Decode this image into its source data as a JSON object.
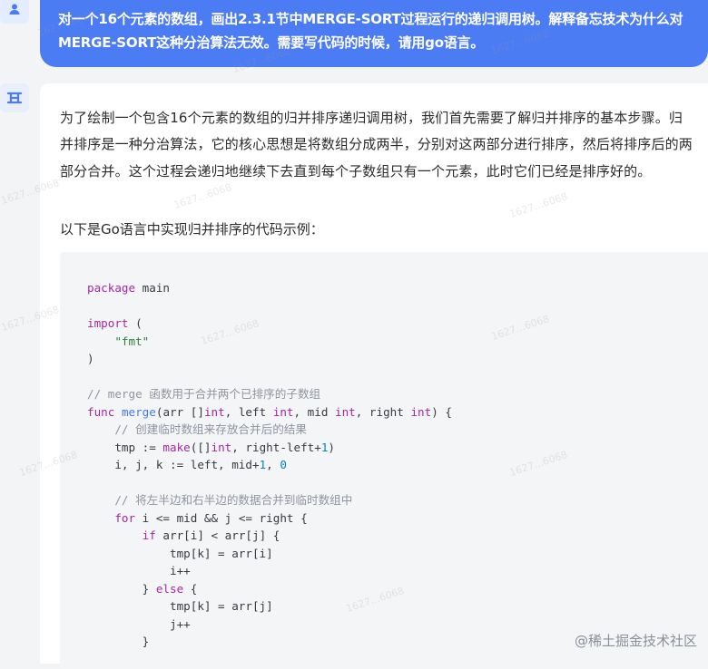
{
  "question": {
    "text": "对一个16个元素的数组，画出2.3.1节中MERGE-SORT过程运行的递归调用树。解释备忘技术为什么对MERGE-SORT这种分治算法无效。需要写代码的时候，请用go语言。"
  },
  "answer": {
    "paragraph": "为了绘制一个包含16个元素的数组的归并排序递归调用树，我们首先需要了解归并排序的基本步骤。归并排序是一种分治算法，它的核心思想是将数组分成两半，分别对这两部分进行排序，然后将排序后的两部分合并。这个过程会递归地继续下去直到每个子数组只有一个元素，此时它们已经是排序好的。",
    "lead": "以下是Go语言中实现归并排序的代码示例："
  },
  "code": [
    [
      {
        "t": "package",
        "c": "kw"
      },
      {
        "t": " main",
        "c": ""
      }
    ],
    [],
    [
      {
        "t": "import",
        "c": "kw"
      },
      {
        "t": " (",
        "c": ""
      }
    ],
    [
      {
        "t": "    ",
        "c": ""
      },
      {
        "t": "\"fmt\"",
        "c": "str"
      }
    ],
    [
      {
        "t": ")",
        "c": ""
      }
    ],
    [],
    [
      {
        "t": "// merge 函数用于合并两个已排序的子数组",
        "c": "cm"
      }
    ],
    [
      {
        "t": "func",
        "c": "kw"
      },
      {
        "t": " ",
        "c": ""
      },
      {
        "t": "merge",
        "c": "fn"
      },
      {
        "t": "(arr []",
        "c": ""
      },
      {
        "t": "int",
        "c": "kw"
      },
      {
        "t": ", left ",
        "c": ""
      },
      {
        "t": "int",
        "c": "kw"
      },
      {
        "t": ", mid ",
        "c": ""
      },
      {
        "t": "int",
        "c": "kw"
      },
      {
        "t": ", right ",
        "c": ""
      },
      {
        "t": "int",
        "c": "kw"
      },
      {
        "t": ") {",
        "c": ""
      }
    ],
    [
      {
        "t": "    ",
        "c": ""
      },
      {
        "t": "// 创建临时数组来存放合并后的结果",
        "c": "cm"
      }
    ],
    [
      {
        "t": "    tmp := ",
        "c": ""
      },
      {
        "t": "make",
        "c": "kw"
      },
      {
        "t": "([]",
        "c": ""
      },
      {
        "t": "int",
        "c": "kw"
      },
      {
        "t": ", right-left+",
        "c": ""
      },
      {
        "t": "1",
        "c": "num"
      },
      {
        "t": ")",
        "c": ""
      }
    ],
    [
      {
        "t": "    i, j, k := left, mid+",
        "c": ""
      },
      {
        "t": "1",
        "c": "num"
      },
      {
        "t": ", ",
        "c": ""
      },
      {
        "t": "0",
        "c": "num"
      }
    ],
    [],
    [
      {
        "t": "    ",
        "c": ""
      },
      {
        "t": "// 将左半边和右半边的数据合并到临时数组中",
        "c": "cm"
      }
    ],
    [
      {
        "t": "    ",
        "c": ""
      },
      {
        "t": "for",
        "c": "kw"
      },
      {
        "t": " i <= mid && j <= right {",
        "c": ""
      }
    ],
    [
      {
        "t": "        ",
        "c": ""
      },
      {
        "t": "if",
        "c": "kw"
      },
      {
        "t": " arr[i] < arr[j] {",
        "c": ""
      }
    ],
    [
      {
        "t": "            tmp[k] = arr[i]",
        "c": ""
      }
    ],
    [
      {
        "t": "            i++",
        "c": ""
      }
    ],
    [
      {
        "t": "        } ",
        "c": ""
      },
      {
        "t": "else",
        "c": "kw"
      },
      {
        "t": " {",
        "c": ""
      }
    ],
    [
      {
        "t": "            tmp[k] = arr[j]",
        "c": ""
      }
    ],
    [
      {
        "t": "            j++",
        "c": ""
      }
    ],
    [
      {
        "t": "        }",
        "c": ""
      }
    ]
  ],
  "watermarks": [
    "1627...6068",
    "1627...6068",
    "1627...6068",
    "1627...6068",
    "1627...6068",
    "1627...6068",
    "1627...6068",
    "1627...6068",
    "1627...6068",
    "1627...6068",
    "1627...6068",
    "1627...6068"
  ],
  "footer": {
    "text": "@稀土掘金技术社区"
  },
  "icons": {
    "user": "user-icon",
    "bot": "bot-logo-icon"
  }
}
